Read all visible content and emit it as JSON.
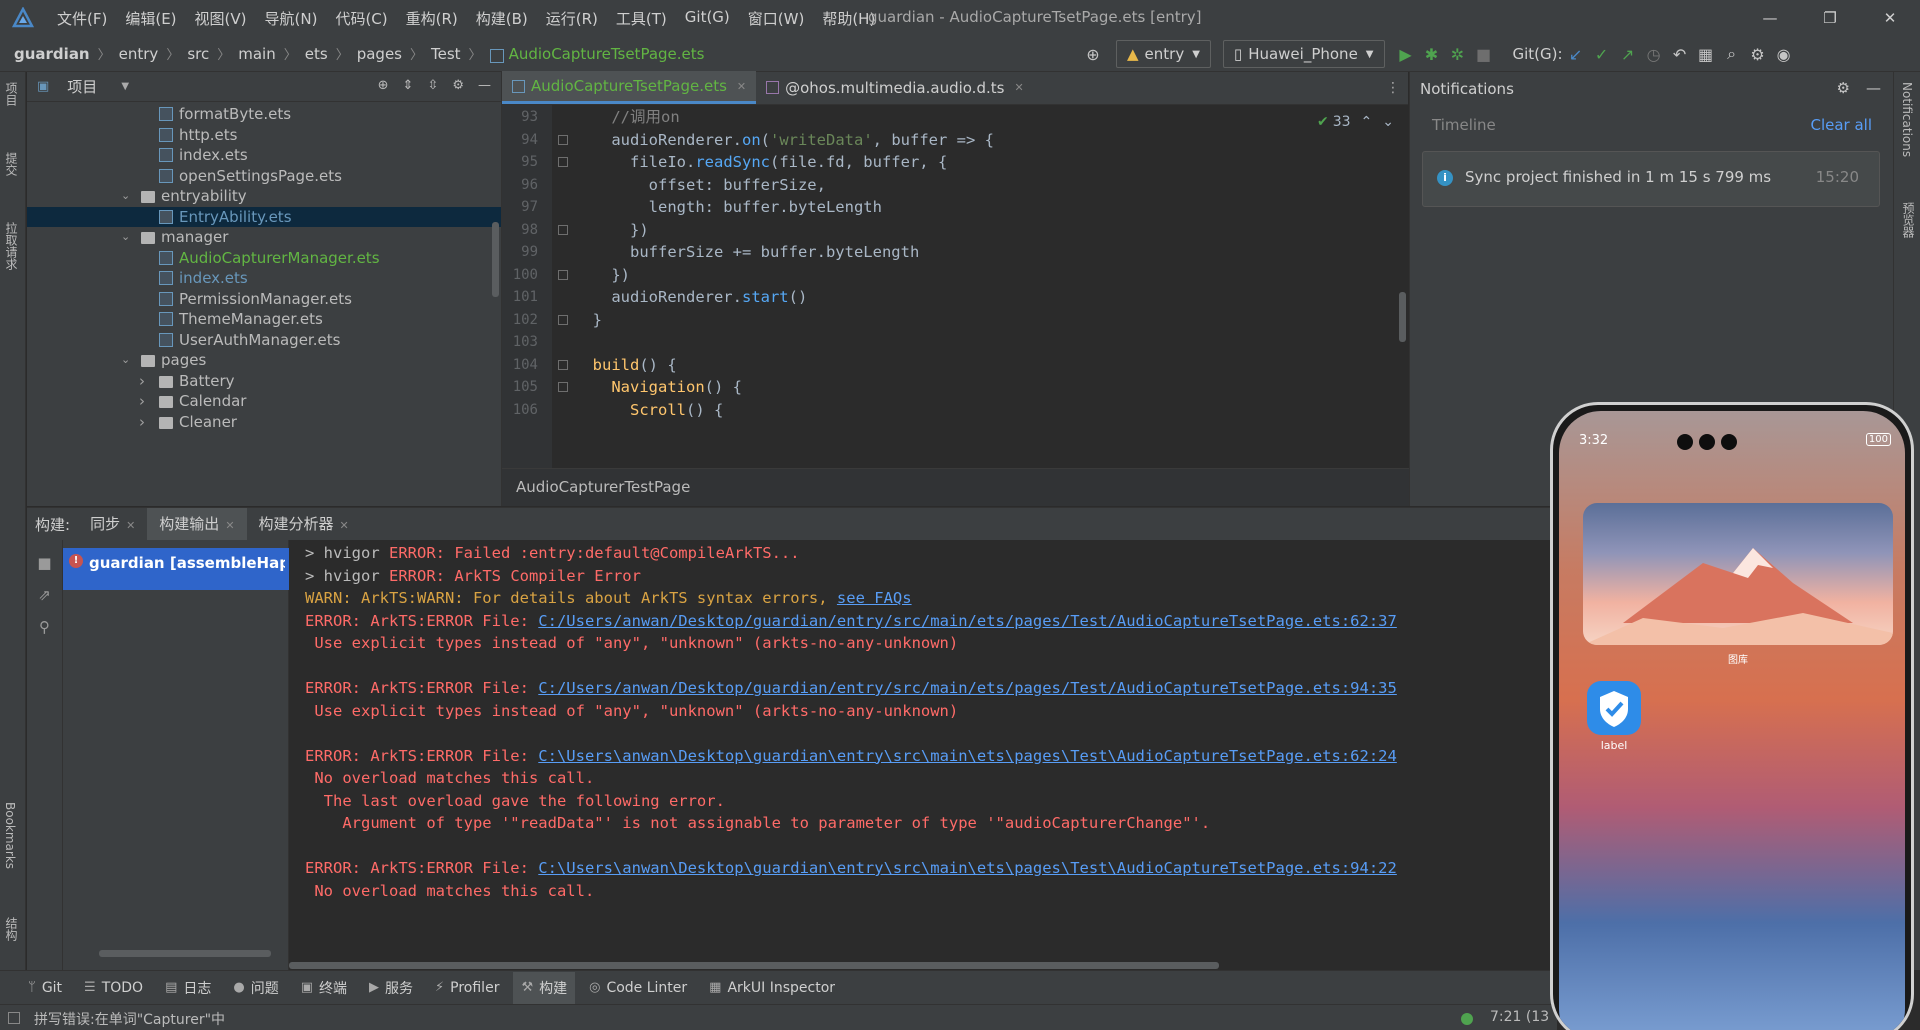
{
  "titlebar": {
    "menu": [
      "文件(F)",
      "编辑(E)",
      "视图(V)",
      "导航(N)",
      "代码(C)",
      "重构(R)",
      "构建(B)",
      "运行(R)",
      "工具(T)",
      "Git(G)",
      "窗口(W)",
      "帮助(H)"
    ],
    "window_title": "guardian - AudioCaptureTsetPage.ets [entry]"
  },
  "breadcrumb": {
    "items": [
      "guardian",
      "entry",
      "src",
      "main",
      "ets",
      "pages",
      "Test"
    ],
    "file": "AudioCaptureTsetPage.ets"
  },
  "toolbar": {
    "module": "entry",
    "device": "Huawei_Phone",
    "git_label": "Git(G):"
  },
  "left_strip": {
    "tabs": [
      "项目",
      "提交",
      "拉取请求",
      "Bookmarks",
      "结构"
    ]
  },
  "project": {
    "title": "项目",
    "tree": [
      {
        "label": "formatByte.ets",
        "kind": "file",
        "depth": 3,
        "style": "normal"
      },
      {
        "label": "http.ets",
        "kind": "file",
        "depth": 3,
        "style": "normal"
      },
      {
        "label": "index.ets",
        "kind": "file",
        "depth": 3,
        "style": "normal"
      },
      {
        "label": "openSettingsPage.ets",
        "kind": "file",
        "depth": 3,
        "style": "normal"
      },
      {
        "label": "entryability",
        "kind": "folder",
        "depth": 2,
        "expanded": true,
        "style": "normal"
      },
      {
        "label": "EntryAbility.ets",
        "kind": "file",
        "depth": 3,
        "style": "blue",
        "selected": true
      },
      {
        "label": "manager",
        "kind": "folder",
        "depth": 2,
        "expanded": true,
        "style": "normal"
      },
      {
        "label": "AudioCapturerManager.ets",
        "kind": "file",
        "depth": 3,
        "style": "mod"
      },
      {
        "label": "index.ets",
        "kind": "file",
        "depth": 3,
        "style": "blue"
      },
      {
        "label": "PermissionManager.ets",
        "kind": "file",
        "depth": 3,
        "style": "normal"
      },
      {
        "label": "ThemeManager.ets",
        "kind": "file",
        "depth": 3,
        "style": "normal"
      },
      {
        "label": "UserAuthManager.ets",
        "kind": "file",
        "depth": 3,
        "style": "normal"
      },
      {
        "label": "pages",
        "kind": "folder",
        "depth": 2,
        "expanded": true,
        "style": "normal"
      },
      {
        "label": "Battery",
        "kind": "folder",
        "depth": 3,
        "expanded": false,
        "style": "normal"
      },
      {
        "label": "Calendar",
        "kind": "folder",
        "depth": 3,
        "expanded": false,
        "style": "normal"
      },
      {
        "label": "Cleaner",
        "kind": "folder",
        "depth": 3,
        "expanded": false,
        "style": "normal"
      }
    ]
  },
  "editor": {
    "tabs": [
      {
        "label": "AudioCaptureTsetPage.ets",
        "active": true
      },
      {
        "label": "@ohos.multimedia.audio.d.ts",
        "active": false
      }
    ],
    "inspection_count": "33",
    "footer": "AudioCapturerTestPage",
    "lines": [
      {
        "n": "93",
        "t": [
          [
            "c",
            "    //调用on"
          ]
        ]
      },
      {
        "n": "94",
        "t": [
          [
            "",
            "    audioRenderer."
          ],
          [
            "fnblue",
            "on"
          ],
          [
            "",
            "("
          ],
          [
            "s",
            "'writeData'"
          ],
          [
            "",
            ", buffer => {"
          ]
        ]
      },
      {
        "n": "95",
        "t": [
          [
            "",
            "      fileIo."
          ],
          [
            "fnblue",
            "readSync"
          ],
          [
            "",
            "(file.fd, buffer, {"
          ]
        ]
      },
      {
        "n": "96",
        "t": [
          [
            "",
            "        offset: bufferSize,"
          ]
        ]
      },
      {
        "n": "97",
        "t": [
          [
            "",
            "        length: buffer.byteLength"
          ]
        ]
      },
      {
        "n": "98",
        "t": [
          [
            "",
            "      })"
          ]
        ]
      },
      {
        "n": "99",
        "t": [
          [
            "",
            "      bufferSize += buffer.byteLength"
          ]
        ]
      },
      {
        "n": "100",
        "t": [
          [
            "",
            "    })"
          ]
        ]
      },
      {
        "n": "101",
        "t": [
          [
            "",
            "    audioRenderer."
          ],
          [
            "fnblue",
            "start"
          ],
          [
            "",
            "()"
          ]
        ]
      },
      {
        "n": "102",
        "t": [
          [
            "",
            "  }"
          ]
        ]
      },
      {
        "n": "103",
        "t": [
          [
            "",
            ""
          ]
        ]
      },
      {
        "n": "104",
        "t": [
          [
            "",
            "  "
          ],
          [
            "f",
            "build"
          ],
          [
            "",
            "() {"
          ]
        ]
      },
      {
        "n": "105",
        "t": [
          [
            "",
            "    "
          ],
          [
            "f",
            "Navigation"
          ],
          [
            "",
            "() {"
          ]
        ]
      },
      {
        "n": "106",
        "t": [
          [
            "",
            "      "
          ],
          [
            "f",
            "Scroll"
          ],
          [
            "",
            "() {"
          ]
        ]
      }
    ]
  },
  "notifications": {
    "title": "Notifications",
    "timeline": "Timeline",
    "clear_all": "Clear all",
    "message": "Sync project finished in 1 m 15 s 799 ms",
    "time": "15:20"
  },
  "right_strip": {
    "tabs": [
      "Notifications",
      "预览器"
    ]
  },
  "build": {
    "label": "构建:",
    "tabs": [
      {
        "label": "同步",
        "active": false
      },
      {
        "label": "构建输出",
        "active": true
      },
      {
        "label": "构建分析器",
        "active": false
      }
    ],
    "tree_item": "guardian [assembleHap]: 失败",
    "output": [
      {
        "type": "mixed",
        "parts": [
          [
            "plain",
            "> hvigor "
          ],
          [
            "err",
            "ERROR: Failed :entry:default@CompileArkTS..."
          ]
        ]
      },
      {
        "type": "mixed",
        "parts": [
          [
            "plain",
            "> hvigor "
          ],
          [
            "err",
            "ERROR: ArkTS Compiler Error"
          ]
        ]
      },
      {
        "type": "mixed",
        "parts": [
          [
            "warn",
            "WARN: ArkTS:WARN: For details about ArkTS syntax errors, "
          ],
          [
            "link",
            "see FAQs"
          ]
        ]
      },
      {
        "type": "mixed",
        "parts": [
          [
            "err",
            "ERROR: ArkTS:ERROR File: "
          ],
          [
            "link",
            "C:/Users/anwan/Desktop/guardian/entry/src/main/ets/pages/Test/AudioCaptureTsetPage.ets:62:37"
          ]
        ]
      },
      {
        "type": "mixed",
        "parts": [
          [
            "err",
            " Use explicit types instead of \"any\", \"unknown\" (arkts-no-any-unknown)"
          ]
        ]
      },
      {
        "type": "mixed",
        "parts": [
          [
            "plain",
            ""
          ]
        ]
      },
      {
        "type": "mixed",
        "parts": [
          [
            "err",
            "ERROR: ArkTS:ERROR File: "
          ],
          [
            "link",
            "C:/Users/anwan/Desktop/guardian/entry/src/main/ets/pages/Test/AudioCaptureTsetPage.ets:94:35"
          ]
        ]
      },
      {
        "type": "mixed",
        "parts": [
          [
            "err",
            " Use explicit types instead of \"any\", \"unknown\" (arkts-no-any-unknown)"
          ]
        ]
      },
      {
        "type": "mixed",
        "parts": [
          [
            "plain",
            ""
          ]
        ]
      },
      {
        "type": "mixed",
        "parts": [
          [
            "err",
            "ERROR: ArkTS:ERROR File: "
          ],
          [
            "link",
            "C:\\Users\\anwan\\Desktop\\guardian\\entry\\src\\main\\ets\\pages\\Test\\AudioCaptureTsetPage.ets:62:24"
          ]
        ]
      },
      {
        "type": "mixed",
        "parts": [
          [
            "err",
            " No overload matches this call."
          ]
        ]
      },
      {
        "type": "mixed",
        "parts": [
          [
            "err",
            "  The last overload gave the following error."
          ]
        ]
      },
      {
        "type": "mixed",
        "parts": [
          [
            "err",
            "    Argument of type '\"readData\"' is not assignable to parameter of type '\"audioCapturerChange\"'."
          ]
        ]
      },
      {
        "type": "mixed",
        "parts": [
          [
            "plain",
            ""
          ]
        ]
      },
      {
        "type": "mixed",
        "parts": [
          [
            "err",
            "ERROR: ArkTS:ERROR File: "
          ],
          [
            "link",
            "C:\\Users\\anwan\\Desktop\\guardian\\entry\\src\\main\\ets\\pages\\Test\\AudioCaptureTsetPage.ets:94:22"
          ]
        ]
      },
      {
        "type": "mixed",
        "parts": [
          [
            "err",
            " No overload matches this call."
          ]
        ]
      }
    ]
  },
  "bottom_tools": [
    {
      "label": "Git",
      "icon": "git-branch-icon"
    },
    {
      "label": "TODO",
      "icon": "list-icon"
    },
    {
      "label": "日志",
      "icon": "log-icon"
    },
    {
      "label": "问题",
      "icon": "problems-icon"
    },
    {
      "label": "终端",
      "icon": "terminal-icon"
    },
    {
      "label": "服务",
      "icon": "services-icon"
    },
    {
      "label": "Profiler",
      "icon": "profiler-icon"
    },
    {
      "label": "构建",
      "icon": "hammer-icon",
      "active": true
    },
    {
      "label": "Code Linter",
      "icon": "linter-icon"
    },
    {
      "label": "ArkUI Inspector",
      "icon": "inspector-icon"
    }
  ],
  "statusbar": {
    "message": "拼写错误:在单词\"Capturer\"中",
    "position": "7:21 (13"
  },
  "phone": {
    "time": "3:32",
    "battery": "100",
    "gallery_label": "图库",
    "app_label": "label"
  }
}
